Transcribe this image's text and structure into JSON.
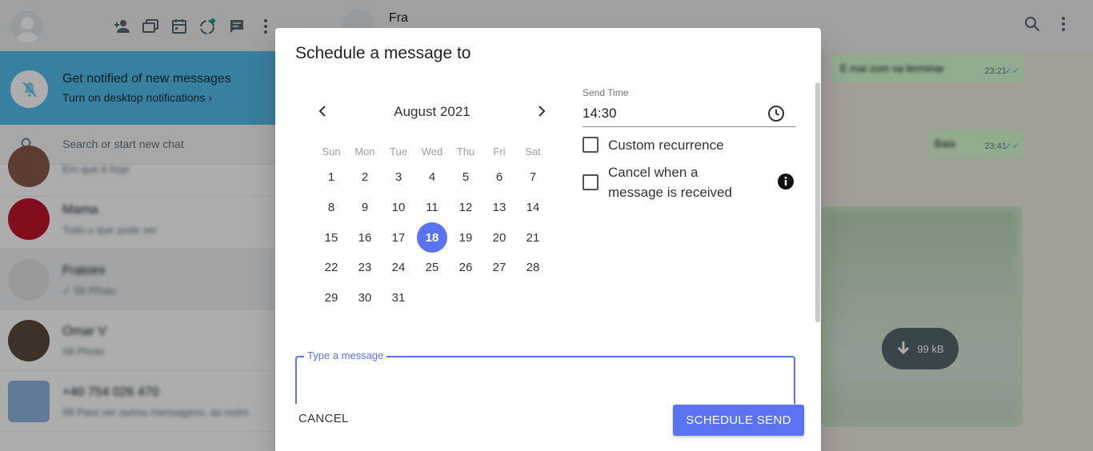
{
  "sidebar": {
    "header_icons": [
      "add-contact-icon",
      "communities-icon",
      "calendar-icon",
      "status-icon",
      "new-chat-icon",
      "menu-icon"
    ],
    "notification": {
      "title": "Get notified of new messages",
      "link": "Turn on desktop notifications ›"
    },
    "search": {
      "placeholder": "Search or start new chat"
    },
    "chats": [
      {
        "name": "",
        "preview": "Em que é hoje",
        "avatar_color": "#8a5a4a"
      },
      {
        "name": "Mama",
        "preview": "Todo o que pode ser",
        "avatar_color": "#c0142b"
      },
      {
        "name": "Fratoini",
        "preview": "✓ 58 Photo",
        "avatar_color": "#e3e3e3"
      },
      {
        "name": "Omar V",
        "preview": "58 Photo",
        "avatar_color": "#5a4a3a"
      },
      {
        "name": "+40 754 026 470",
        "preview": "98 Para ver outros mensagens, ao outro",
        "avatar_color": "#8fb4e0"
      }
    ]
  },
  "conversation": {
    "name": "Fra",
    "messages": [
      {
        "text": "E mai zum sa terminar",
        "time": "23:21",
        "check": "✓✓"
      },
      {
        "text": "Baia",
        "time": "23:41",
        "check": "✓✓"
      }
    ],
    "media_size": "99 kB"
  },
  "dialog": {
    "title": "Schedule a message to",
    "calendar": {
      "month_label": "August 2021",
      "weekdays": [
        "Sun",
        "Mon",
        "Tue",
        "Wed",
        "Thu",
        "Fri",
        "Sat"
      ],
      "first_weekday_index": 0,
      "days_in_month": 31,
      "selected_day": 18
    },
    "send_time": {
      "label": "Send Time",
      "value": "14:30"
    },
    "options": {
      "custom_recurrence": "Custom recurrence",
      "cancel_when_received": "Cancel when a message is received"
    },
    "message_field": {
      "label": "Type a message",
      "value": ""
    },
    "buttons": {
      "cancel": "CANCEL",
      "schedule_send": "SCHEDULE SEND"
    }
  },
  "colors": {
    "accent": "#5a73f0",
    "notification": "#53bdeb",
    "bubble": "#d9fdd3"
  }
}
